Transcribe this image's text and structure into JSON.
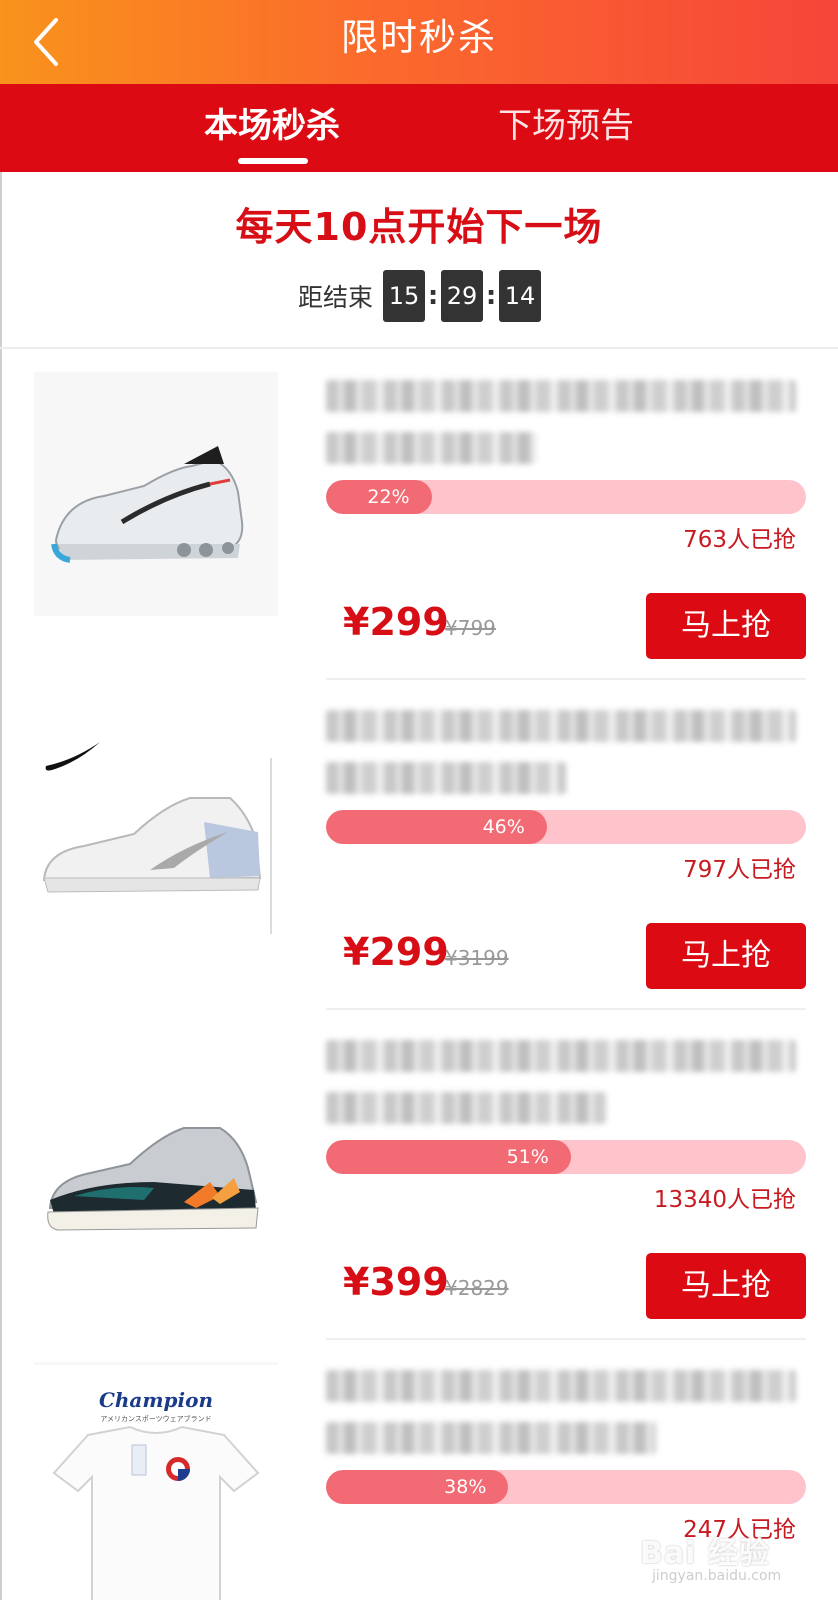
{
  "header": {
    "title": "限时秒杀",
    "back_icon": "chevron-left-icon"
  },
  "tabs": [
    {
      "label": "本场秒杀",
      "active": true
    },
    {
      "label": "下场预告",
      "active": false
    }
  ],
  "promo": {
    "title": "每天10点开始下一场",
    "countdown_label": "距结束",
    "hours": "15",
    "minutes": "29",
    "seconds": "14",
    "separator": ":"
  },
  "products": [
    {
      "image": "air-max-sneaker-image",
      "progress_label": "22%",
      "progress": 0.22,
      "sold": "763人已抢",
      "price": "¥299",
      "original_price": "¥799",
      "button": "马上抢"
    },
    {
      "image": "jordan-low-sneaker-image",
      "progress_label": "46%",
      "progress": 0.46,
      "sold": "797人已抢",
      "price": "¥299",
      "original_price": "¥3199",
      "button": "马上抢"
    },
    {
      "image": "yeezy-700-sneaker-image",
      "progress_label": "51%",
      "progress": 0.51,
      "sold": "13340人已抢",
      "price": "¥399",
      "original_price": "¥2829",
      "button": "马上抢"
    },
    {
      "image": "champion-tshirt-image",
      "progress_label": "38%",
      "progress": 0.38,
      "sold": "247人已抢"
    }
  ],
  "watermark": {
    "text": "Bai 经验",
    "url": "jingyan.baidu.com"
  },
  "colors": {
    "brand_red": "#dc0a12",
    "price_red": "#d70e16",
    "progress_fill": "#f26b74",
    "progress_track": "#ffc3cc",
    "header_start": "#f9931c",
    "header_end": "#f6453a"
  }
}
